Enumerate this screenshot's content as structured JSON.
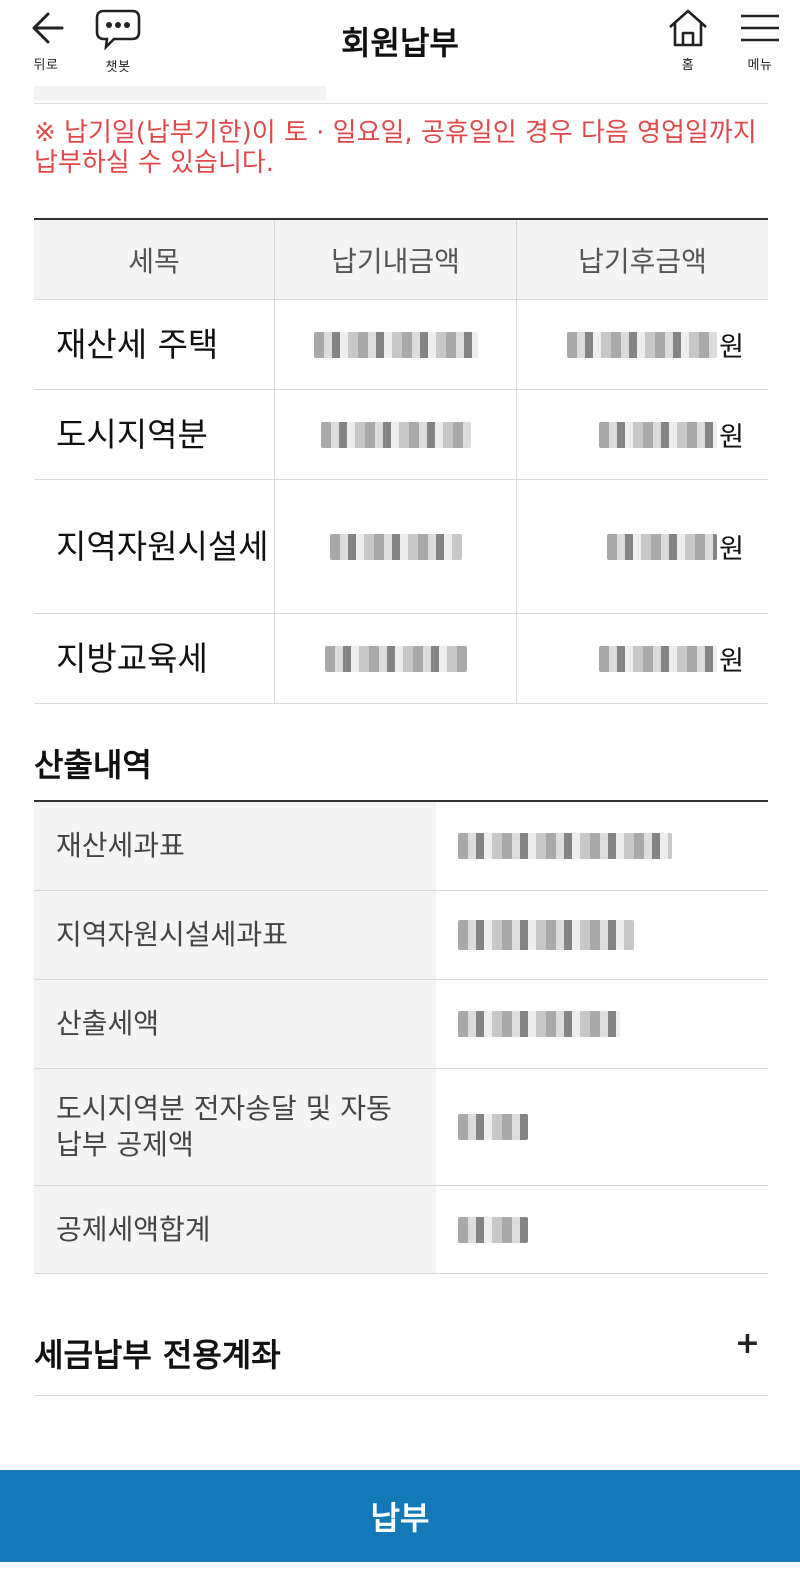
{
  "header": {
    "title": "회원납부",
    "back_label": "뒤로",
    "chatbot_label": "챗봇",
    "home_label": "홈",
    "menu_label": "메뉴"
  },
  "notice": "※ 납기일(납부기한)이 토 · 일요일, 공휴일인 경우 다음 영업일까지 납부하실 수 있습니다.",
  "tax_table": {
    "columns": [
      "세목",
      "납기내금액",
      "납기후금액"
    ],
    "currency_unit": "원",
    "rows": [
      {
        "name": "재산세 주택"
      },
      {
        "name": "도시지역분"
      },
      {
        "name": "지역자원시설세"
      },
      {
        "name": "지방교육세"
      }
    ]
  },
  "calculation": {
    "title": "산출내역",
    "rows": [
      {
        "label": "재산세과표"
      },
      {
        "label": "지역자원시설세과표"
      },
      {
        "label": "산출세액"
      },
      {
        "label": "도시지역분 전자송달 및 자동납부 공제액"
      },
      {
        "label": "공제세액합계"
      }
    ]
  },
  "account_section": {
    "title": "세금납부 전용계좌",
    "toggle": "+"
  },
  "pay_button": "납부",
  "colors": {
    "notice_red": "#e0484a",
    "pay_button_blue": "#1479b8",
    "table_header_bg": "#f4f4f4"
  },
  "icons": [
    "back-arrow-icon",
    "chat-bubble-icon",
    "home-icon",
    "hamburger-menu-icon"
  ]
}
